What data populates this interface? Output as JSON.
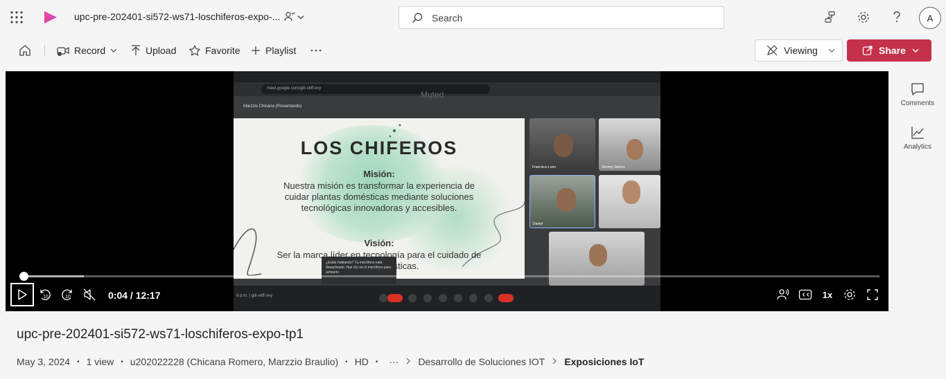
{
  "topbar": {
    "doc_title": "upc-pre-202401-si572-ws71-loschiferos-expo-...",
    "search_placeholder": "Search",
    "avatar_initial": "A",
    "icons": [
      "app-launcher-icon",
      "stream-logo-icon",
      "people-icon",
      "chevron-down-icon",
      "search-icon",
      "org-explorer-icon",
      "gear-icon",
      "help-icon"
    ]
  },
  "commandbar": {
    "record_label": "Record",
    "upload_label": "Upload",
    "favorite_label": "Favorite",
    "playlist_label": "Playlist",
    "viewing_label": "Viewing",
    "share_label": "Share"
  },
  "player": {
    "time_display": "0:04 / 12:17",
    "speed_label": "1x",
    "played_fraction": 0.005,
    "buffered_fraction": 0.075,
    "skip_back_label": "10",
    "skip_forward_label": "10",
    "frame": {
      "muted_text": "Muted",
      "url_text": "meet.google.com/gdi-vkff-ovy",
      "presenter_text": "Marzzio Chicana (Presentando)",
      "slide_title": "LOS CHIFEROS",
      "mission_heading": "Misión:",
      "mission_text": "Nuestra misión es transformar la experiencia de cuidar plantas domésticas mediante soluciones tecnológicas innovadoras y accesibles.",
      "vision_heading": "Visión:",
      "vision_text": "Ser la marca líder en tecnología para el cuidado de plantas domésticas.",
      "dialog_text": "¿Estás hablando? Tu micrófono está desactivado. Haz clic en el micrófono para activarlo.",
      "meet_time": "6 p.m. | gdi-vkff-ovy",
      "tiles": [
        {
          "name": "Francisco Leon"
        },
        {
          "name": "Jeremy Jaimes"
        },
        {
          "name": "Daniel"
        },
        {
          "name": ""
        },
        {
          "name": ""
        }
      ]
    }
  },
  "side_pane": {
    "comments_label": "Comments",
    "analytics_label": "Analytics"
  },
  "video": {
    "title": "upc-pre-202401-si572-ws71-loschiferos-expo-tp1",
    "date": "May 3, 2024",
    "views": "1 view",
    "owner": "u202022228 (Chicana Romero, Marzzio Braulio)",
    "quality": "HD",
    "more": "···",
    "breadcrumb_1": "Desarrollo de Soluciones IOT",
    "breadcrumb_2": "Exposiciones IoT"
  },
  "colors": {
    "share_button": "#c4314b",
    "background": "#f5f5f5",
    "player_bg": "#000000"
  }
}
